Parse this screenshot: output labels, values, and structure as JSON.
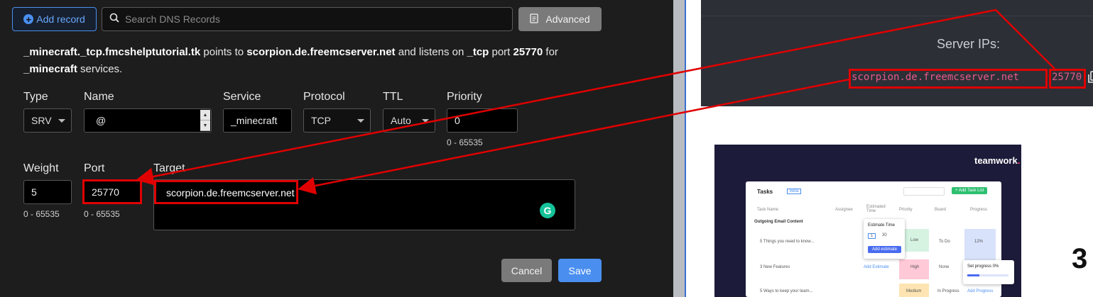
{
  "toolbar": {
    "add_label": "Add record",
    "search_placeholder": "Search DNS Records",
    "advanced_label": "Advanced"
  },
  "description": {
    "record": "_minecraft._tcp.fmcshelptutorial.tk",
    "points_to_text": "points to",
    "target": "scorpion.de.freemcserver.net",
    "listens_text": "and listens on",
    "protocol": "_tcp",
    "port_text": "port",
    "port": "25770",
    "for_text": "for",
    "service": "_minecraft",
    "services_text": "services."
  },
  "form": {
    "type": {
      "label": "Type",
      "value": "SRV"
    },
    "name": {
      "label": "Name",
      "value": "@"
    },
    "service": {
      "label": "Service",
      "value": "_minecraft"
    },
    "protocol": {
      "label": "Protocol",
      "value": "TCP"
    },
    "ttl": {
      "label": "TTL",
      "value": "Auto"
    },
    "priority": {
      "label": "Priority",
      "value": "0",
      "hint": "0 - 65535"
    },
    "weight": {
      "label": "Weight",
      "value": "5",
      "hint": "0 - 65535"
    },
    "port": {
      "label": "Port",
      "value": "25770",
      "hint": "0 - 65535"
    },
    "target": {
      "label": "Target",
      "value": "scorpion.de.freemcserver.net"
    }
  },
  "actions": {
    "cancel_label": "Cancel",
    "save_label": "Save"
  },
  "server_panel": {
    "title": "Server IPs:",
    "host": "scorpion.de.freemcserver.net",
    "port": "25770"
  },
  "teamwork_ad": {
    "logo": "teamwork",
    "tasks_title": "Tasks",
    "beta": "Beta",
    "add_task_list": "+ Add Task List",
    "columns": [
      "Task Name",
      "Assignee",
      "Estimated Time",
      "Priority",
      "Board",
      "Progress"
    ],
    "group": "Outgoing Email Content",
    "rows": [
      {
        "task": "5 Things you need to know...",
        "priority": "Low",
        "board": "To Do",
        "progress": "12%"
      },
      {
        "task": "3 New Features",
        "priority": "High",
        "board": "None",
        "progress": ""
      },
      {
        "task": "5 Ways to keep your team...",
        "priority": "Medium",
        "board": "In Progress",
        "progress": "Add Progress"
      }
    ],
    "estimate_popup": {
      "title": "Estimate Time",
      "hours": "1",
      "minutes": "30",
      "button": "Add estimate"
    },
    "add_estimate_link": "Add Estimate",
    "progress_popup": {
      "title": "Set progress 0%"
    },
    "badge_count": "3"
  },
  "step_number": "3"
}
